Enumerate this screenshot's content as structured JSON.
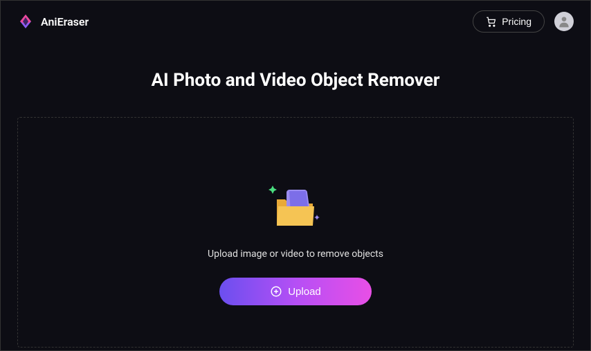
{
  "header": {
    "app_name": "AniEraser",
    "pricing_label": "Pricing"
  },
  "main": {
    "title": "AI Photo and Video Object Remover",
    "upload_hint": "Upload image or video to remove objects",
    "upload_button_label": "Upload"
  },
  "icons": {
    "logo": "anieraser-logo",
    "cart": "cart-icon",
    "avatar": "user-avatar",
    "plus": "plus-circle-icon",
    "folder": "folder-media-icon"
  },
  "colors": {
    "background": "#0d0d14",
    "text": "#ffffff",
    "border_dashed": "#333333",
    "gradient_start": "#6b4fef",
    "gradient_mid": "#b54ff5",
    "gradient_end": "#e84fe6",
    "logo_purple": "#8b5cf6",
    "logo_pink": "#ec4899"
  }
}
